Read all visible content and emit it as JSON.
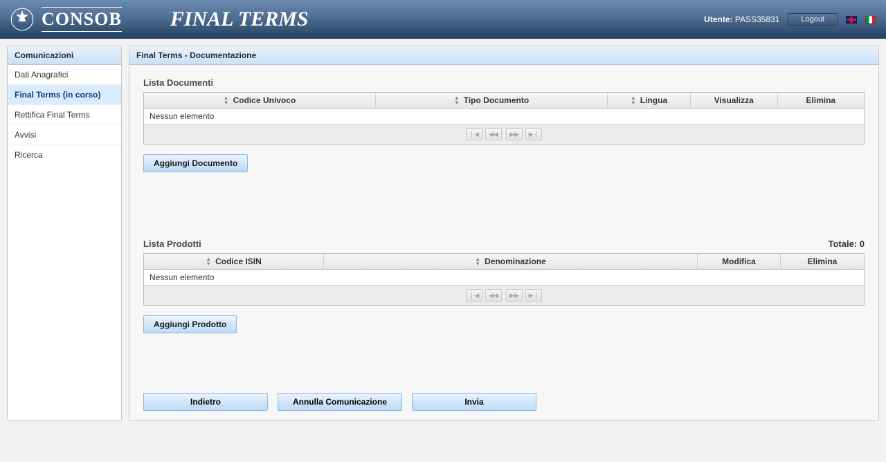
{
  "header": {
    "brand": "CONSOB",
    "title": "FINAL TERMS",
    "user_label": "Utente:",
    "user_value": "PASS35831",
    "logout": "Logout"
  },
  "sidebar": {
    "title": "Comunicazioni",
    "items": [
      {
        "label": "Dati Anagrafici"
      },
      {
        "label": "Final Terms (in corso)"
      },
      {
        "label": "Rettifica Final Terms"
      },
      {
        "label": "Avvisi"
      },
      {
        "label": "Ricerca"
      }
    ],
    "active_index": 1
  },
  "main": {
    "panel_title": "Final Terms - Documentazione",
    "documents": {
      "title": "Lista Documenti",
      "columns": [
        "Codice Univoco",
        "Tipo Documento",
        "Lingua",
        "Visualizza",
        "Elimina"
      ],
      "empty": "Nessun elemento",
      "add_button": "Aggiungi Documento"
    },
    "products": {
      "title": "Lista Prodotti",
      "total_label": "Totale:",
      "total_value": "0",
      "columns": [
        "Codice ISIN",
        "Denominazione",
        "Modifica",
        "Elimina"
      ],
      "empty": "Nessun elemento",
      "add_button": "Aggiungi Prodotto"
    },
    "footer_buttons": {
      "back": "Indietro",
      "cancel": "Annulla Comunicazione",
      "send": "Invia"
    }
  }
}
